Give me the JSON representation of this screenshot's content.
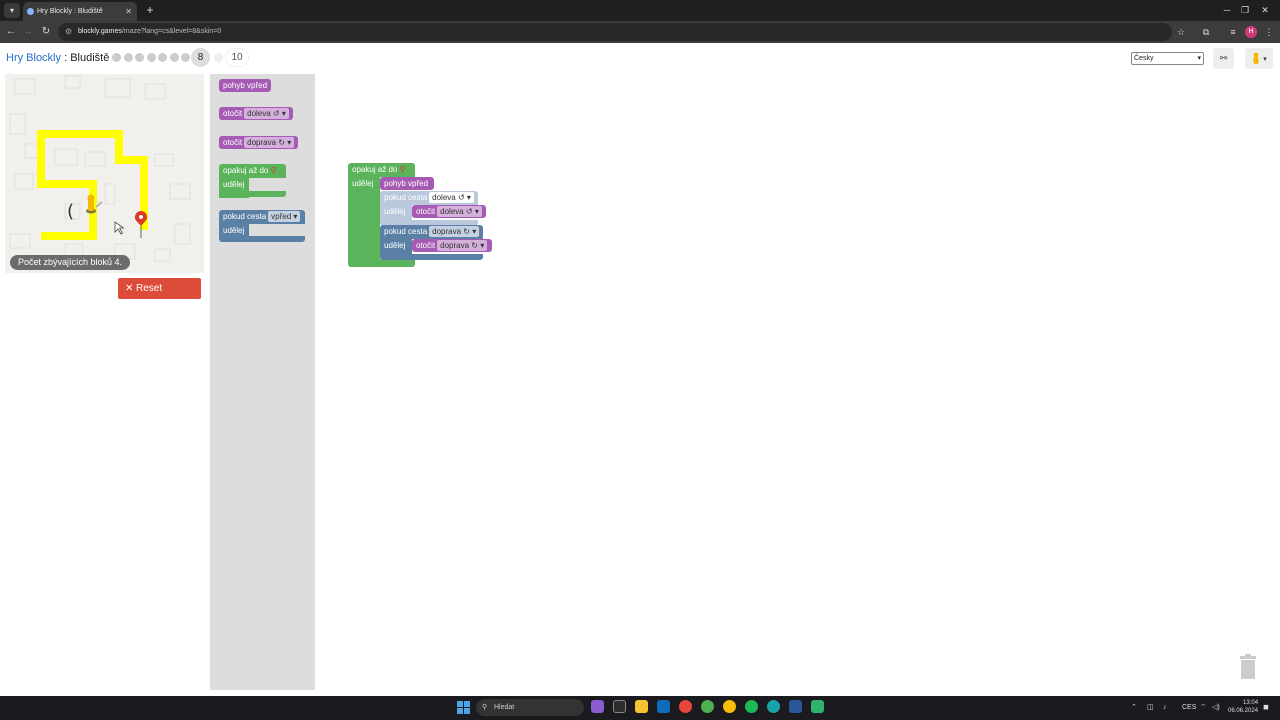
{
  "browser": {
    "tab_title": "Hry Blockly : Bludiště",
    "new_tab": "+",
    "url_host": "blockly.games",
    "url_path": "/maze?lang=cs&level=8&skin=0"
  },
  "header": {
    "app_title": "Hry Blockly",
    "separator": " : ",
    "page_title": "Bludiště",
    "current_level": "8",
    "last_level": "10",
    "completed_levels": 7,
    "language": "Česky"
  },
  "maze": {
    "blocks_remaining_label": "Počet zbývajících bloků 4.",
    "reset_label": "Reset",
    "reset_icon": "x-icon"
  },
  "toolbox": {
    "move_forward": "pohyb vpřed",
    "turn_prefix": "otočit",
    "turn_left": "doleva ↺",
    "turn_right": "doprava ↻",
    "repeat_until": "opakuj až do",
    "do": "udělej",
    "if_path": "pokud cesta",
    "path_ahead": "vpřed"
  },
  "program": {
    "repeat_until": "opakuj až do",
    "do": "udělej",
    "move_forward": "pohyb vpřed",
    "if_path": "pokud cesta",
    "turn_prefix": "otočit",
    "left": "doleva ↺",
    "right": "doprava ↻"
  },
  "taskbar": {
    "search_placeholder": "Hledat",
    "lang": "CES",
    "time": "13:04",
    "date": "06.06.2024"
  },
  "colors": {
    "movement": "#a55bb3",
    "loop": "#5bb35b",
    "logic": "#5b80a5",
    "path": "#ffff00",
    "reset": "#dd4b39"
  }
}
